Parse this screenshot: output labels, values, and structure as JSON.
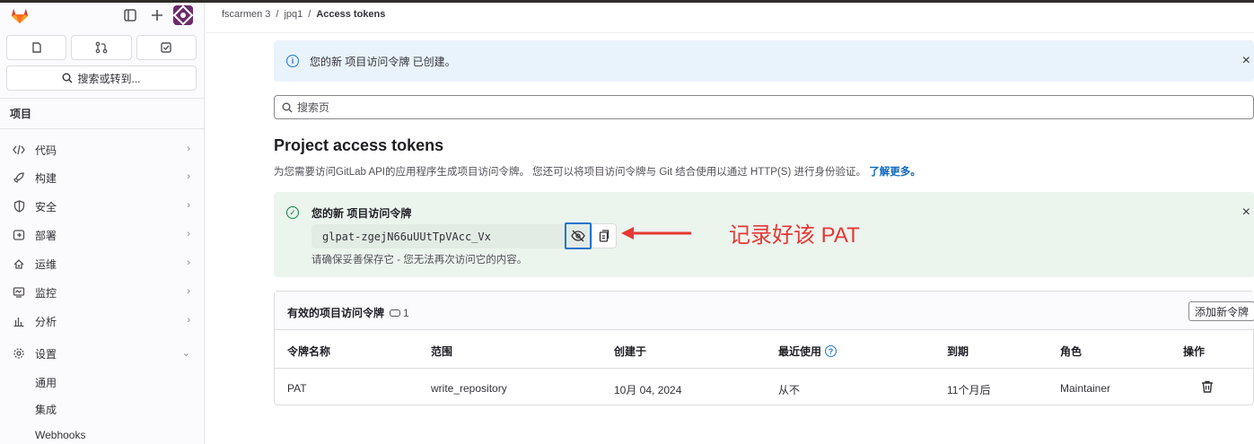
{
  "breadcrumb": [
    "fscarmen 3",
    "jpq1",
    "Access tokens"
  ],
  "sidebar": {
    "search_label": "搜索或转到...",
    "section": "项目",
    "items": [
      {
        "label": "代码",
        "icon": "code-icon"
      },
      {
        "label": "构建",
        "icon": "rocket-icon"
      },
      {
        "label": "安全",
        "icon": "shield-icon"
      },
      {
        "label": "部署",
        "icon": "deploy-icon"
      },
      {
        "label": "运维",
        "icon": "cloud-icon"
      },
      {
        "label": "监控",
        "icon": "monitor-icon"
      },
      {
        "label": "分析",
        "icon": "chart-icon"
      },
      {
        "label": "设置",
        "icon": "gear-icon"
      }
    ],
    "sub_items": [
      "通用",
      "集成",
      "Webhooks"
    ]
  },
  "info_alert": {
    "text": "您的新 项目访问令牌 已创建。"
  },
  "page_search": {
    "placeholder": "搜索页"
  },
  "title": "Project access tokens",
  "description": {
    "text": "为您需要访问GitLab API的应用程序生成项目访问令牌。 您还可以将项目访问令牌与 Git 结合使用以通过 HTTP(S) 进行身份验证。",
    "link": "了解更多。"
  },
  "token_alert": {
    "heading": "您的新 项目访问令牌",
    "token": "glpat-zgejN66uUUtTpVAcc_Vx",
    "note": "请确保妥善保存它 - 您无法再次访问它的内容。"
  },
  "annotation": {
    "text": "记录好该 PAT",
    "color": "#e53935"
  },
  "tokens_table": {
    "title": "有效的项目访问令牌",
    "count": "1",
    "add_button": "添加新令牌",
    "columns": [
      "令牌名称",
      "范围",
      "创建于",
      "最近使用",
      "到期",
      "角色",
      "操作"
    ],
    "rows": [
      {
        "name": "PAT",
        "scope": "write_repository",
        "created": "10月 04, 2024",
        "last_used": "从不",
        "expires": "11个月后",
        "role": "Maintainer"
      }
    ]
  },
  "colors": {
    "accent": "#1f75cb",
    "success": "#108548",
    "info_bg": "#e9f3fc",
    "success_bg": "#ecf4ee"
  }
}
